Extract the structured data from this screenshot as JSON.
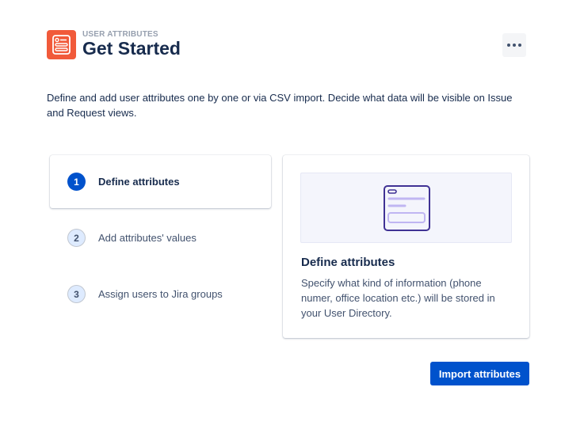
{
  "header": {
    "eyebrow": "USER ATTRIBUTES",
    "title": "Get Started",
    "logo_icon": "user-attributes-app-icon",
    "more_icon": "more-horizontal-icon"
  },
  "description": "Define and add user attributes one by one or via CSV import. Decide what data will be visible on Issue and Request views.",
  "steps": [
    {
      "number": "1",
      "label": "Define attributes",
      "active": true
    },
    {
      "number": "2",
      "label": "Add attributes' values",
      "active": false
    },
    {
      "number": "3",
      "label": "Assign users to Jira groups",
      "active": false
    }
  ],
  "detail": {
    "illustration_icon": "form-document-icon",
    "title": "Define attributes",
    "text": "Specify what kind of information (phone numer, office location etc.) will be stored in your User Directory."
  },
  "actions": {
    "import_label": "Import attributes"
  },
  "colors": {
    "brand": "#f15a3a",
    "primary": "#0052cc",
    "text": "#172b4d",
    "illustration_stroke": "#403294"
  }
}
